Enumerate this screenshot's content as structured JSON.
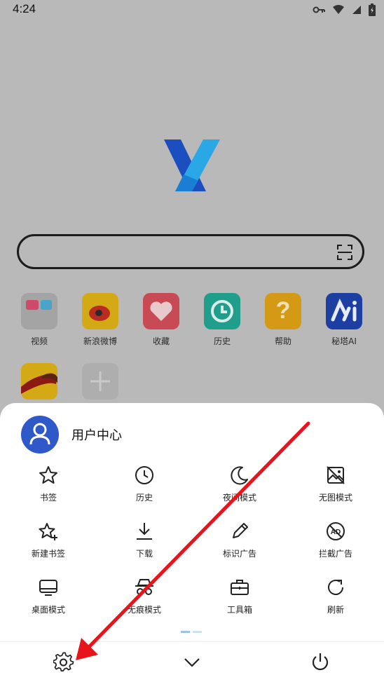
{
  "status": {
    "time": "4:24"
  },
  "shortcuts": [
    {
      "label": "视频"
    },
    {
      "label": "新浪微博"
    },
    {
      "label": "收藏"
    },
    {
      "label": "历史"
    },
    {
      "label": "帮助"
    },
    {
      "label": "秘塔AI"
    },
    {
      "label": ""
    },
    {
      "label": ""
    }
  ],
  "user": {
    "label": "用户中心"
  },
  "menu": [
    {
      "label": "书签",
      "icon": "star-icon"
    },
    {
      "label": "历史",
      "icon": "clock-icon"
    },
    {
      "label": "夜间模式",
      "icon": "moon-icon"
    },
    {
      "label": "无图模式",
      "icon": "no-image-icon"
    },
    {
      "label": "新建书签",
      "icon": "star-plus-icon"
    },
    {
      "label": "下载",
      "icon": "download-icon"
    },
    {
      "label": "标识广告",
      "icon": "pencil-icon"
    },
    {
      "label": "拦截广告",
      "icon": "ad-block-icon"
    },
    {
      "label": "桌面模式",
      "icon": "monitor-icon"
    },
    {
      "label": "无痕模式",
      "icon": "incognito-icon"
    },
    {
      "label": "工具箱",
      "icon": "toolbox-icon"
    },
    {
      "label": "刷新",
      "icon": "refresh-icon"
    }
  ],
  "colors": {
    "accent": "#2f58c9",
    "overlay": "#b9b9b9",
    "arrow": "#e8141c"
  }
}
